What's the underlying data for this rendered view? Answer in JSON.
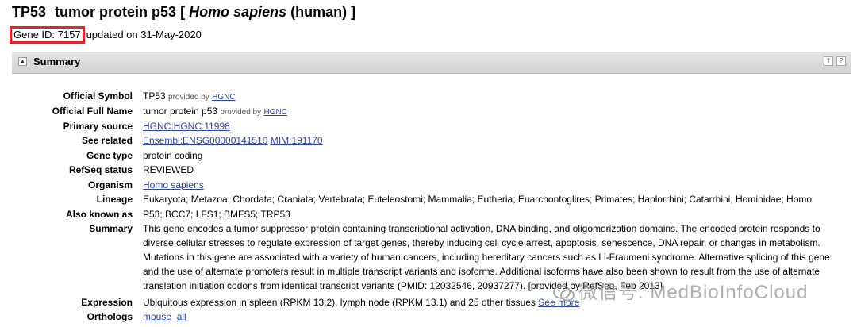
{
  "header": {
    "symbol": "TP53",
    "name": "tumor protein p53",
    "bracket_open": "[",
    "species": "Homo sapiens",
    "common": "(human)",
    "bracket_close": "]",
    "gene_id": "Gene ID: 7157",
    "updated": "updated on 31-May-2020"
  },
  "summary_bar": {
    "title": "Summary",
    "toggle_glyph": "▲",
    "up_glyph": "⇑",
    "help_glyph": "?"
  },
  "fields": {
    "official_symbol": {
      "label": "Official Symbol",
      "value": "TP53",
      "provided_by": "provided by",
      "link": "HGNC"
    },
    "official_full_name": {
      "label": "Official Full Name",
      "value": "tumor protein p53",
      "provided_by": "provided by",
      "link": "HGNC"
    },
    "primary_source": {
      "label": "Primary source",
      "link": "HGNC:HGNC:11998"
    },
    "see_related": {
      "label": "See related",
      "links": [
        "Ensembl:ENSG00000141510",
        "MIM:191170"
      ]
    },
    "gene_type": {
      "label": "Gene type",
      "value": "protein coding"
    },
    "refseq_status": {
      "label": "RefSeq status",
      "value": "REVIEWED"
    },
    "organism": {
      "label": "Organism",
      "link": "Homo sapiens"
    },
    "lineage": {
      "label": "Lineage",
      "value": "Eukaryota; Metazoa; Chordata; Craniata; Vertebrata; Euteleostomi; Mammalia; Eutheria; Euarchontoglires; Primates; Haplorrhini; Catarrhini; Hominidae; Homo"
    },
    "also_known_as": {
      "label": "Also known as",
      "value": "P53; BCC7; LFS1; BMFS5; TRP53"
    },
    "summary": {
      "label": "Summary",
      "value": "This gene encodes a tumor suppressor protein containing transcriptional activation, DNA binding, and oligomerization domains. The encoded protein responds to diverse cellular stresses to regulate expression of target genes, thereby inducing cell cycle arrest, apoptosis, senescence, DNA repair, or changes in metabolism. Mutations in this gene are associated with a variety of human cancers, including hereditary cancers such as Li-Fraumeni syndrome. Alternative splicing of this gene and the use of alternate promoters result in multiple transcript variants and isoforms. Additional isoforms have also been shown to result from the use of alternate translation initiation codons from identical transcript variants (PMID: 12032546, 20937277). [provided by RefSeq, Feb 2013]"
    },
    "expression": {
      "label": "Expression",
      "value": "Ubiquitous expression in spleen (RPKM 13.2), lymph node (RPKM 13.1) and 25 other tissues",
      "link": "See more"
    },
    "orthologs": {
      "label": "Orthologs",
      "links": [
        "mouse",
        "all"
      ]
    }
  },
  "watermark": {
    "text": "微信号: MedBioInfoCloud"
  },
  "colors": {
    "link": "#2d44a8",
    "highlight_box": "#e8242b",
    "bar_bg": "#dadada"
  }
}
